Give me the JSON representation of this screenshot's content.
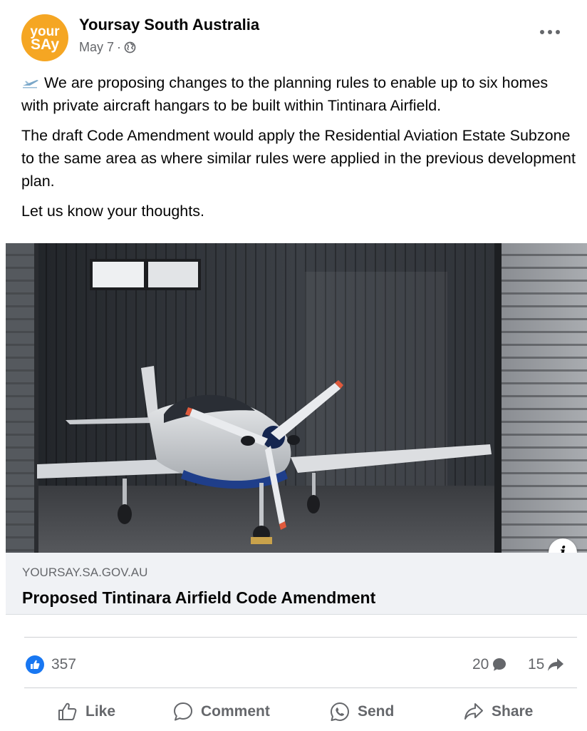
{
  "header": {
    "avatar_line1": "your",
    "avatar_line2": "SAy",
    "page_name": "Yoursay South Australia",
    "date": "May 7",
    "separator": "·"
  },
  "post": {
    "paragraph1": "We are proposing changes to the planning rules to enable up to six homes with private aircraft hangars to be built within Tintinara Airfield.",
    "paragraph2": "The draft Code Amendment would apply the Residential Aviation Estate Subzone to the same area as where similar rules were applied in the previous development plan.",
    "paragraph3": "Let us know your thoughts."
  },
  "link": {
    "domain": "YOURSAY.SA.GOV.AU",
    "title": "Proposed Tintinara Airfield Code Amendment",
    "info_glyph": "i"
  },
  "stats": {
    "reactions": "357",
    "comments": "20",
    "shares": "15"
  },
  "actions": {
    "like": "Like",
    "comment": "Comment",
    "send": "Send",
    "share": "Share"
  },
  "colors": {
    "accent": "#1877f2",
    "avatar": "#f5a623",
    "muted": "#65676b"
  }
}
